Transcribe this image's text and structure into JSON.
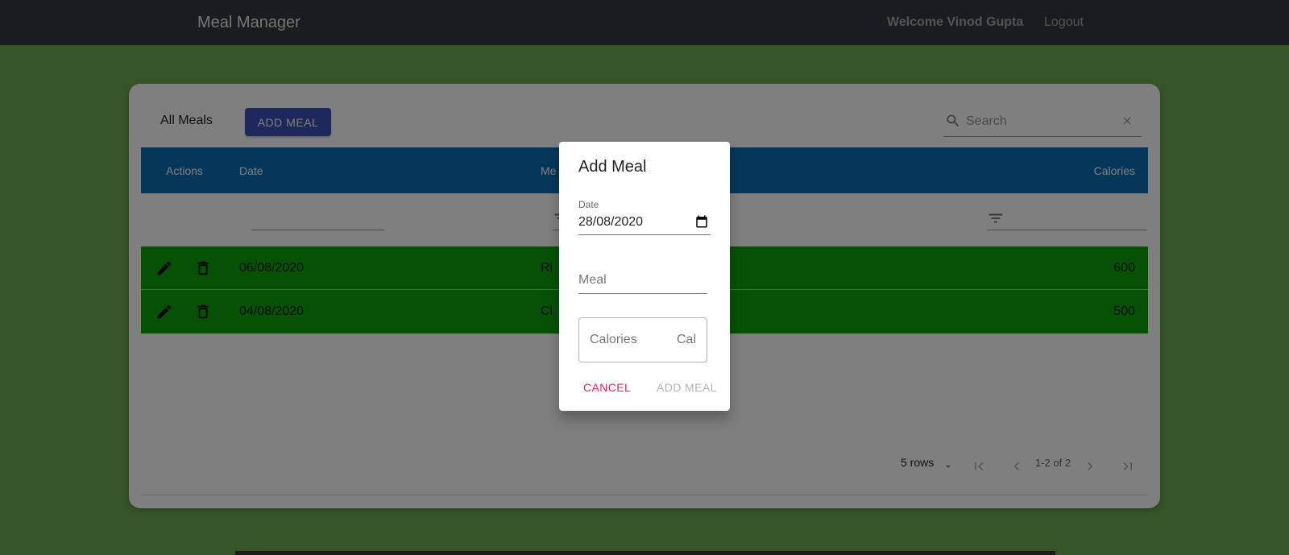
{
  "navbar": {
    "brand": "Meal Manager",
    "welcome": "Welcome Vinod Gupta",
    "logout": "Logout"
  },
  "toolbar": {
    "title": "All Meals",
    "add_button": "ADD MEAL",
    "search_placeholder": "Search"
  },
  "table": {
    "headers": {
      "actions": "Actions",
      "date": "Date",
      "meal": "Me",
      "calories": "Calories"
    },
    "rows": [
      {
        "date": "06/08/2020",
        "meal": "Ri",
        "calories": "600"
      },
      {
        "date": "04/08/2020",
        "meal": "Cl",
        "calories": "500"
      }
    ]
  },
  "pagination": {
    "rows_per_page": "5 rows",
    "range": "1-2 of 2"
  },
  "dialog": {
    "title": "Add Meal",
    "date_label": "Date",
    "date_value": "28/08/2020",
    "meal_label": "Meal",
    "calories_label": "Calories",
    "calories_unit": "Cal",
    "cancel": "CANCEL",
    "add": "ADD MEAL"
  },
  "colors": {
    "page_background": "#6aa84f",
    "navbar": "#343a40",
    "table_header": "#0a6eb4",
    "row_background": "#0aa50a",
    "add_button": "#3f51b5",
    "cancel_text": "#e91e63"
  },
  "icons": {
    "search": "search-icon",
    "clear": "close-icon",
    "filter": "filter-icon",
    "edit": "pencil-icon",
    "delete": "trash-icon",
    "calendar": "calendar-icon",
    "first_page": "first-page-icon",
    "prev_page": "chevron-left-icon",
    "next_page": "chevron-right-icon",
    "last_page": "last-page-icon",
    "dropdown": "caret-down-icon"
  }
}
